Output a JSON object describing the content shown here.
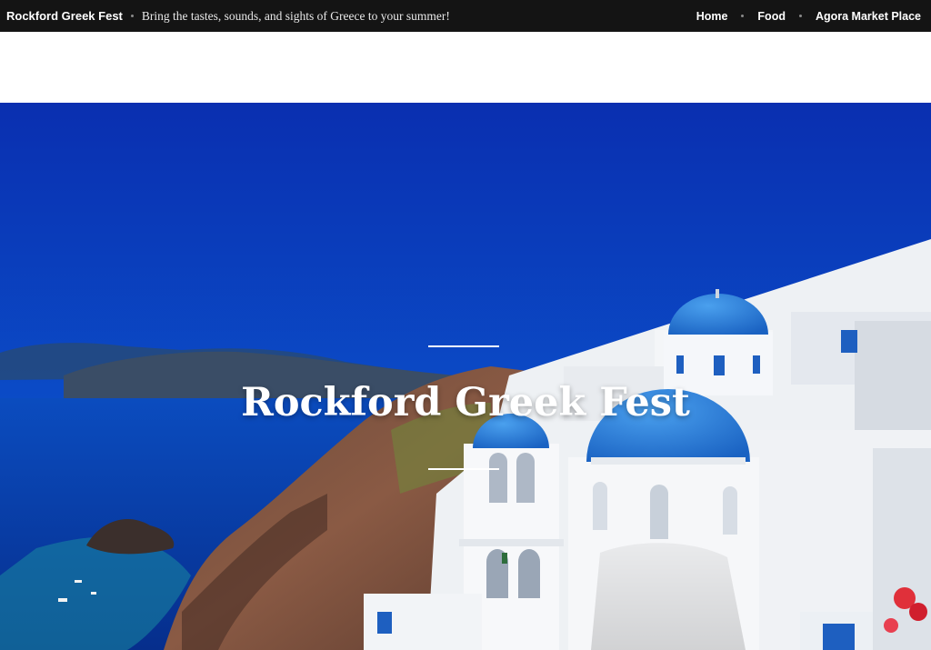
{
  "header": {
    "site_title": "Rockford Greek Fest",
    "tagline": "Bring the tastes, sounds, and sights of Greece to your summer!"
  },
  "nav": {
    "items": [
      {
        "label": "Home"
      },
      {
        "label": "Food"
      },
      {
        "label": "Agora Market Place"
      }
    ]
  },
  "hero": {
    "title": "Rockford Greek Fest",
    "image_alt": "Santorini blue-domed churches overlooking the Aegean Sea"
  },
  "colors": {
    "topbar_bg": "#141414",
    "sky": "#0a3fb8",
    "sea": "#0a3aa8",
    "dome": "#2a7fd6"
  }
}
